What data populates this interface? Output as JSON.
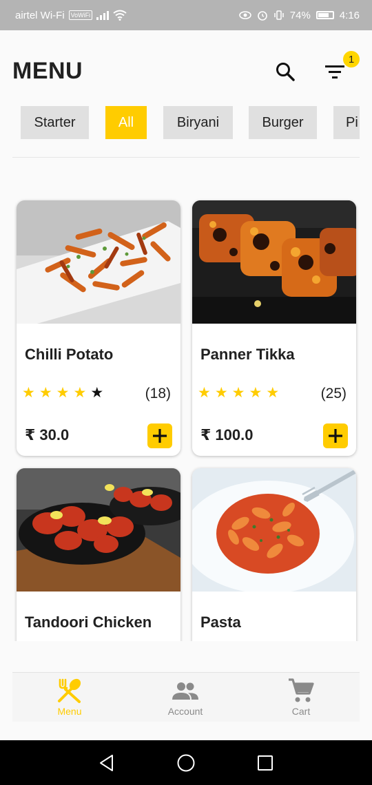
{
  "status_bar": {
    "carrier": "airtel Wi-Fi",
    "wifi_tag": "VoWiFi",
    "battery": "74%",
    "time": "4:16"
  },
  "header": {
    "title": "MENU",
    "search_icon": "search-icon",
    "filter_icon": "filter-icon",
    "filter_badge": "1"
  },
  "categories": [
    {
      "label": "Starter",
      "active": false
    },
    {
      "label": "All",
      "active": true
    },
    {
      "label": "Biryani",
      "active": false
    },
    {
      "label": "Burger",
      "active": false
    },
    {
      "label": "Pi",
      "active": false
    }
  ],
  "items": [
    {
      "name": "Chilli Potato",
      "rating": 4,
      "rating_max": 5,
      "reviews": "(18)",
      "price": "₹ 30.0",
      "image": "chilli-potato-photo"
    },
    {
      "name": "Panner Tikka",
      "rating": 5,
      "rating_max": 5,
      "reviews": "(25)",
      "price": "₹ 100.0",
      "image": "paneer-tikka-photo"
    },
    {
      "name": "Tandoori Chicken",
      "image": "tandoori-chicken-photo"
    },
    {
      "name": "Pasta",
      "image": "pasta-photo"
    }
  ],
  "bottom_nav": [
    {
      "label": "Menu",
      "icon": "fork-spoon-icon",
      "active": true
    },
    {
      "label": "Account",
      "icon": "people-icon",
      "active": false
    },
    {
      "label": "Cart",
      "icon": "cart-icon",
      "active": false
    }
  ],
  "colors": {
    "accent": "#ffcc00",
    "chip_bg": "#e0e0e0",
    "text": "#212121",
    "muted": "#8a8a8a"
  }
}
